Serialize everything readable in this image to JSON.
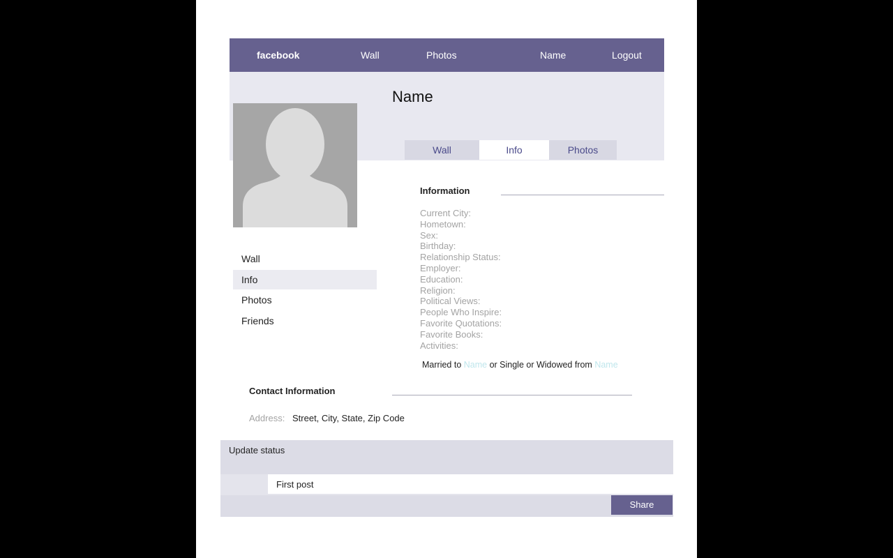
{
  "nav": {
    "brand": "facebook",
    "wall": "Wall",
    "photos": "Photos",
    "name": "Name",
    "logout": "Logout"
  },
  "profile": {
    "name": "Name"
  },
  "tabs": [
    {
      "label": "Wall",
      "active": false
    },
    {
      "label": "Info",
      "active": true
    },
    {
      "label": "Photos",
      "active": false
    }
  ],
  "sidebar": [
    {
      "label": "Wall",
      "selected": false
    },
    {
      "label": "Info",
      "selected": true
    },
    {
      "label": "Photos",
      "selected": false
    },
    {
      "label": "Friends",
      "selected": false
    }
  ],
  "info": {
    "heading": "Information",
    "fields": [
      "Current City:",
      "Hometown:",
      "Sex:",
      "Birthday:",
      "Relationship Status:",
      "Employer:",
      "Education:",
      "Religion:",
      "Political Views:",
      "People Who Inspire:",
      "Favorite Quotations:",
      "Favorite Books:",
      "Activities:"
    ],
    "married": {
      "prefix": "Married to ",
      "link1": "Name",
      "middle": " or Single or Widowed from ",
      "link2": "Name"
    }
  },
  "contact": {
    "heading": "Contact Information",
    "address_label": "Address:",
    "address_value": "Street, City, State, Zip Code"
  },
  "status": {
    "label": "Update status",
    "post_value": "First post",
    "share_label": "Share"
  },
  "colors": {
    "brand": "#66618f",
    "band": "#e8e8f0",
    "link": "#bfe6ec",
    "muted": "#a3a3a3"
  },
  "icons": {
    "avatar": "default-profile-silhouette-icon"
  }
}
